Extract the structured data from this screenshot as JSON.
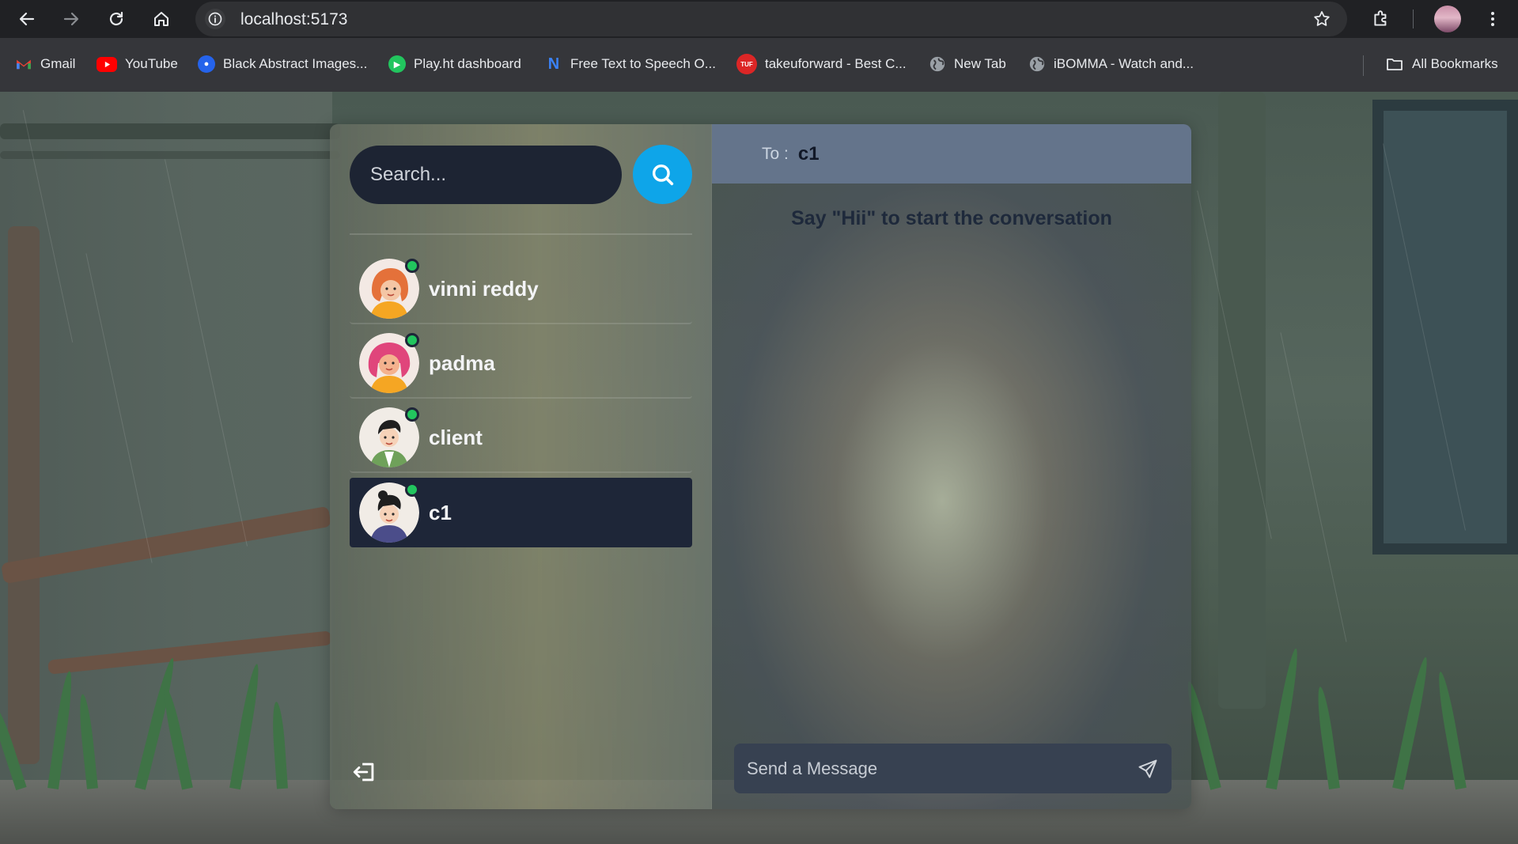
{
  "browser": {
    "url": "localhost:5173",
    "icons": {
      "back": "arrow-left-icon",
      "forward": "arrow-right-icon",
      "reload": "reload-icon",
      "home": "home-icon",
      "site_info": "info-icon",
      "bookmark_star": "star-icon",
      "extensions": "puzzle-icon",
      "menu": "kebab-menu-icon"
    },
    "bookmarks": [
      {
        "label": "Gmail",
        "icon": "gmail-icon",
        "color": "#ea4335"
      },
      {
        "label": "YouTube",
        "icon": "youtube-icon",
        "color": "#ff0000"
      },
      {
        "label": "Black Abstract Images...",
        "icon": "freepik-icon",
        "color": "#2563eb"
      },
      {
        "label": "Play.ht dashboard",
        "icon": "play-icon",
        "color": "#22c55e"
      },
      {
        "label": "Free Text to Speech O...",
        "icon": "n-logo-icon",
        "color": "#3b82f6"
      },
      {
        "label": "takeuforward - Best C...",
        "icon": "tuf-icon",
        "color": "#dc2626"
      },
      {
        "label": "New Tab",
        "icon": "globe-icon",
        "color": "#9aa0a6"
      },
      {
        "label": "iBOMMA - Watch and...",
        "icon": "globe-icon",
        "color": "#9aa0a6"
      }
    ],
    "all_bookmarks": "All Bookmarks"
  },
  "sidebar": {
    "search_placeholder": "Search...",
    "conversations": [
      {
        "name": "vinni reddy",
        "online": true,
        "selected": false
      },
      {
        "name": "padma",
        "online": true,
        "selected": false
      },
      {
        "name": "client",
        "online": true,
        "selected": false
      },
      {
        "name": "c1",
        "online": true,
        "selected": true
      }
    ]
  },
  "chat": {
    "to_label": "To :",
    "to_name": "c1",
    "empty_message": "Say \"Hii\" to start the conversation",
    "input_placeholder": "Send a Message"
  },
  "colors": {
    "accent": "#0ea5e9",
    "online": "#22c55e",
    "selected_conversation": "#1e2638",
    "chat_header": "#64748b"
  }
}
